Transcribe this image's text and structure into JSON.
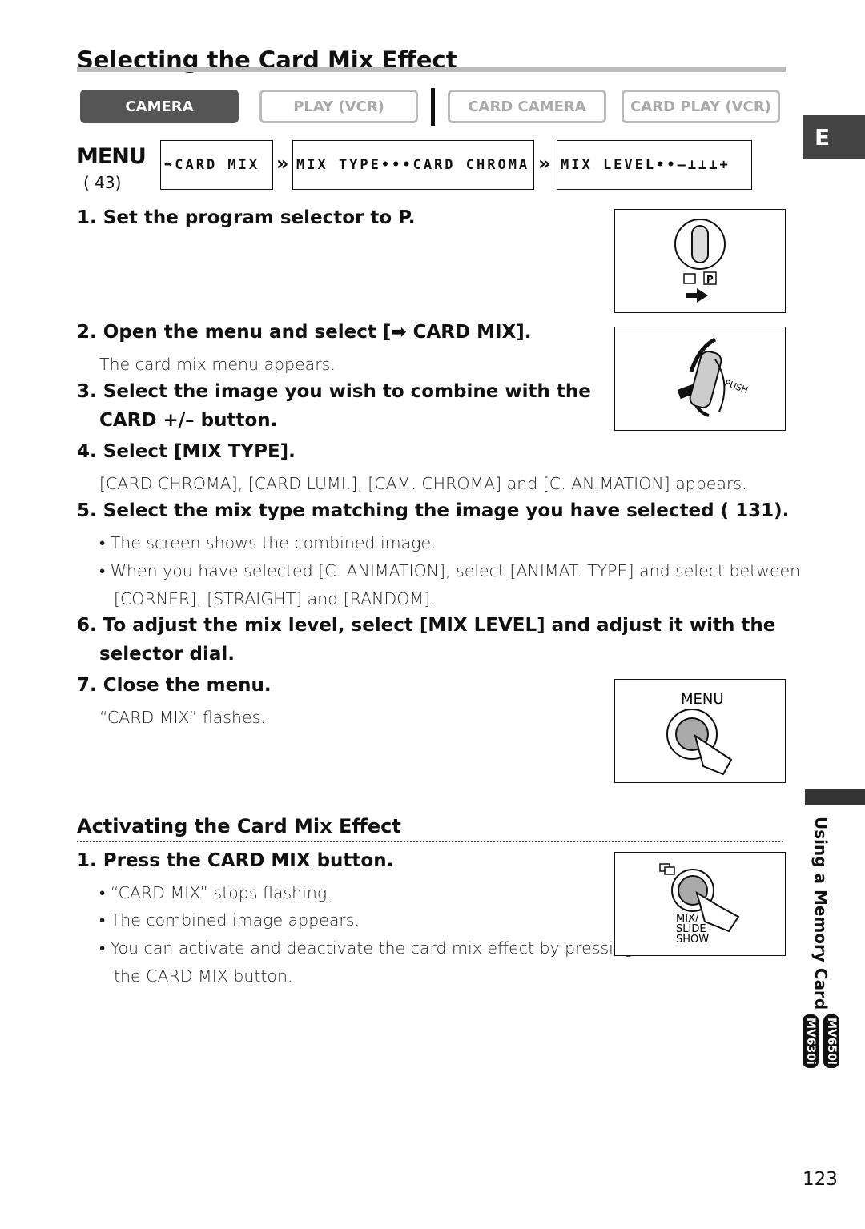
{
  "title": "Selecting the Card Mix Effect",
  "modes": [
    {
      "label": "CAMERA",
      "active": true
    },
    {
      "label": "PLAY (VCR)",
      "active": false
    },
    {
      "label": "CARD CAMERA",
      "active": false
    },
    {
      "label": "CARD PLAY (VCR)",
      "active": false
    }
  ],
  "menu": {
    "logo": "MENU",
    "ref": "( 43)",
    "items": [
      "➡CARD MIX",
      "MIX TYPE•••CARD CHROMA",
      "MIX LEVEL••–⊥⊥⊥+"
    ]
  },
  "side_tab": "E",
  "steps": [
    {
      "num": "1.",
      "text": "Set the program selector to P."
    },
    {
      "num": "2.",
      "text": "Open the menu and select [➡ CARD MIX].",
      "body": "The card mix menu appears."
    },
    {
      "num": "3.",
      "text": "Select the image you wish to combine with the",
      "text2": "CARD +/– button."
    },
    {
      "num": "4.",
      "text": "Select [MIX TYPE].",
      "body": "[CARD CHROMA], [CARD LUMI.], [CAM. CHROMA] and [C. ANIMATION] appears."
    },
    {
      "num": "5.",
      "text": "Select the mix type matching the image you have selected ( 131).",
      "bullets": [
        "• The screen shows the combined image.",
        "• When you have selected [C. ANIMATION], select [ANIMAT. TYPE] and select between",
        "[CORNER], [STRAIGHT] and [RANDOM]."
      ]
    },
    {
      "num": "6.",
      "text": "To adjust the mix level, select [MIX LEVEL] and adjust it with the",
      "text2": "selector dial."
    },
    {
      "num": "7.",
      "text": "Close the menu.",
      "body": "“CARD MIX” flashes."
    }
  ],
  "activating": {
    "heading": "Activating the Card Mix Effect",
    "step": "1. Press the CARD MIX button.",
    "bullets": [
      "• “CARD MIX” stops flashing.",
      "• The combined image appears.",
      "• You can activate and deactivate the card mix effect by pressing",
      "the CARD MIX button."
    ]
  },
  "illustrations": {
    "push": "PUSH",
    "menu": "MENU",
    "mix": [
      "MIX/",
      "SLIDE",
      "SHOW"
    ]
  },
  "section": {
    "badges": [
      "MV650i",
      "MV630i"
    ],
    "label": "Using a Memory Card"
  },
  "page_number": "123"
}
